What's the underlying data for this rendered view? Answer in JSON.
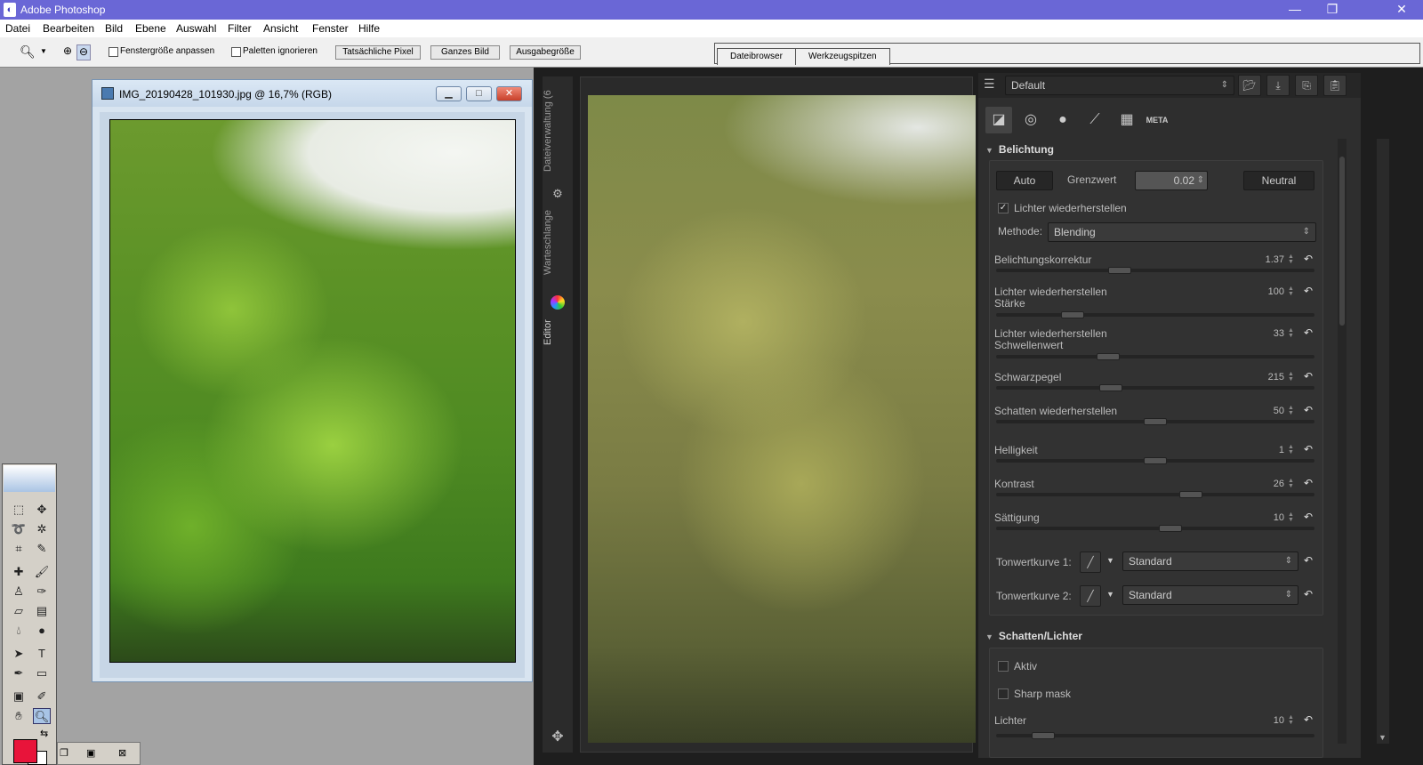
{
  "app": {
    "title": "Adobe Photoshop"
  },
  "menu": [
    "Datei",
    "Bearbeiten",
    "Bild",
    "Ebene",
    "Auswahl",
    "Filter",
    "Ansicht",
    "Fenster",
    "Hilfe"
  ],
  "options": {
    "fit_window": "Fenstergröße anpassen",
    "ignore_palettes": "Paletten ignorieren",
    "actual_pixels": "Tatsächliche Pixel",
    "whole_image": "Ganzes Bild",
    "print_size": "Ausgabegröße"
  },
  "palette_tabs": [
    "Dateibrowser",
    "Werkzeugspitzen"
  ],
  "document": {
    "title": "IMG_20190428_101930.jpg @ 16,7% (RGB)"
  },
  "colors": {
    "foreground": "#e8143a",
    "background": "#ffffff",
    "titlebar": "#6a67d6"
  },
  "rt": {
    "vtabs": {
      "filebrowser": "Dateiverwaltung (6",
      "queue": "Warteschlange",
      "editor": "Editor"
    },
    "profile": "Default",
    "meta_tab": "META",
    "exposure": {
      "header": "Belichtung",
      "auto": "Auto",
      "clip_label": "Grenzwert",
      "clip_value": "0.02",
      "neutral": "Neutral",
      "hl_recovery": "Lichter wiederherstellen",
      "method_label": "Methode:",
      "method_value": "Blending",
      "sliders": [
        {
          "label": "Belichtungskorrektur",
          "value": "1.37",
          "pos": 0.38
        },
        {
          "label": "Lichter wiederherstellen\nStärke",
          "value": "100",
          "pos": 0.22
        },
        {
          "label": "Lichter wiederherstellen\nSchwellenwert",
          "value": "33",
          "pos": 0.34
        },
        {
          "label": "Schwarzpegel",
          "value": "215",
          "pos": 0.35
        },
        {
          "label": "Schatten wiederherstellen",
          "value": "50",
          "pos": 0.5
        },
        {
          "label": "Helligkeit",
          "value": "1",
          "pos": 0.5
        },
        {
          "label": "Kontrast",
          "value": "26",
          "pos": 0.62
        },
        {
          "label": "Sättigung",
          "value": "10",
          "pos": 0.55
        }
      ],
      "curve1_label": "Tonwertkurve 1:",
      "curve1_value": "Standard",
      "curve2_label": "Tonwertkurve 2:",
      "curve2_value": "Standard"
    },
    "shadows": {
      "header": "Schatten/Lichter",
      "active": "Aktiv",
      "sharp_mask": "Sharp mask",
      "highlights_label": "Lichter",
      "highlights_value": "10",
      "highlights_pos": 0.12
    }
  }
}
